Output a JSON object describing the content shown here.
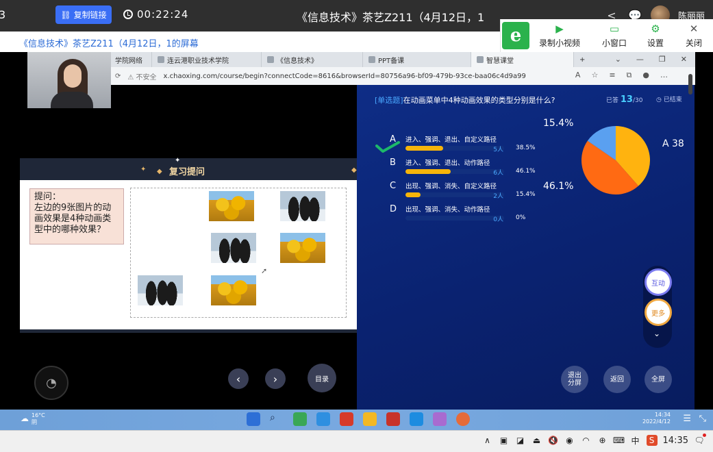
{
  "topbar": {
    "left_digit": "3",
    "copy_link_label": "复制链接",
    "timer": "00:22:24",
    "meeting_title": "《信息技术》茶艺Z211（4月12日，1",
    "user_name": "陈丽丽"
  },
  "share_banner": {
    "title": "《信息技术》茶艺Z211（4月12日，1的屏幕"
  },
  "share_tools": {
    "logo": "e",
    "record_label": "录制小视频",
    "mini_label": "小窗口",
    "settings_label": "设置",
    "close_label": "关闭"
  },
  "browser": {
    "tabs": [
      {
        "label": "学院网络"
      },
      {
        "label": "连云港职业技术学院"
      },
      {
        "label": "《信息技术》"
      },
      {
        "label": "PPT备课"
      },
      {
        "label": "智慧课堂"
      }
    ],
    "new_tab": "+",
    "insecure_label": "不安全",
    "url": "x.chaoxing.com/course/begin?connectCode=8616&browserId=80756a96-bf09-479b-93ce-baa06c4d9a99"
  },
  "slide": {
    "heading": "复习提问",
    "tip_text": "提问：\n左边的9张图片的动画效果是4种动画类型中的哪种效果？",
    "menu_label": "目录"
  },
  "quiz": {
    "type_tag": "[单选题]",
    "question": "在动画菜单中4种动画效果的类型分别是什么?",
    "answered_label": "已答",
    "answered_count": "13",
    "total_count": "/30",
    "ended_label": "已结束",
    "options": [
      {
        "letter": "A",
        "text": "进入、强调、退出、自定义路径",
        "count": "5人",
        "percent": "38.5%",
        "fraction": 0.385
      },
      {
        "letter": "B",
        "text": "进入、强调、退出、动作路径",
        "count": "6人",
        "percent": "46.1%",
        "fraction": 0.461
      },
      {
        "letter": "C",
        "text": "出现、强调、消失、自定义路径",
        "count": "2人",
        "percent": "15.4%",
        "fraction": 0.154
      },
      {
        "letter": "D",
        "text": "出现、强调、消失、动作路径",
        "count": "0人",
        "percent": "0%",
        "fraction": 0
      }
    ],
    "pie_labels": {
      "top_left": "15.4%",
      "right": "A 38",
      "bottom_left": "46.1%"
    },
    "side_interact": "互动",
    "side_more": "更多",
    "exit_split": "退出分屏",
    "back": "返回",
    "fullscreen": "全屏"
  },
  "remote_taskbar": {
    "weather_temp": "16°C",
    "weather_desc": "阴",
    "time": "14:34",
    "date": "2022/4/12"
  },
  "local_taskbar": {
    "ime_label": "中",
    "time": "14:35"
  },
  "colors": {
    "accent_blue": "#3a6ef5",
    "quiz_bg": "#0a2270",
    "bar_fill": "#f6b40a",
    "pie_a": "#ffb30f",
    "pie_b": "#ff6a13",
    "pie_c": "#5aa0f0",
    "check_green": "#1db86a"
  }
}
